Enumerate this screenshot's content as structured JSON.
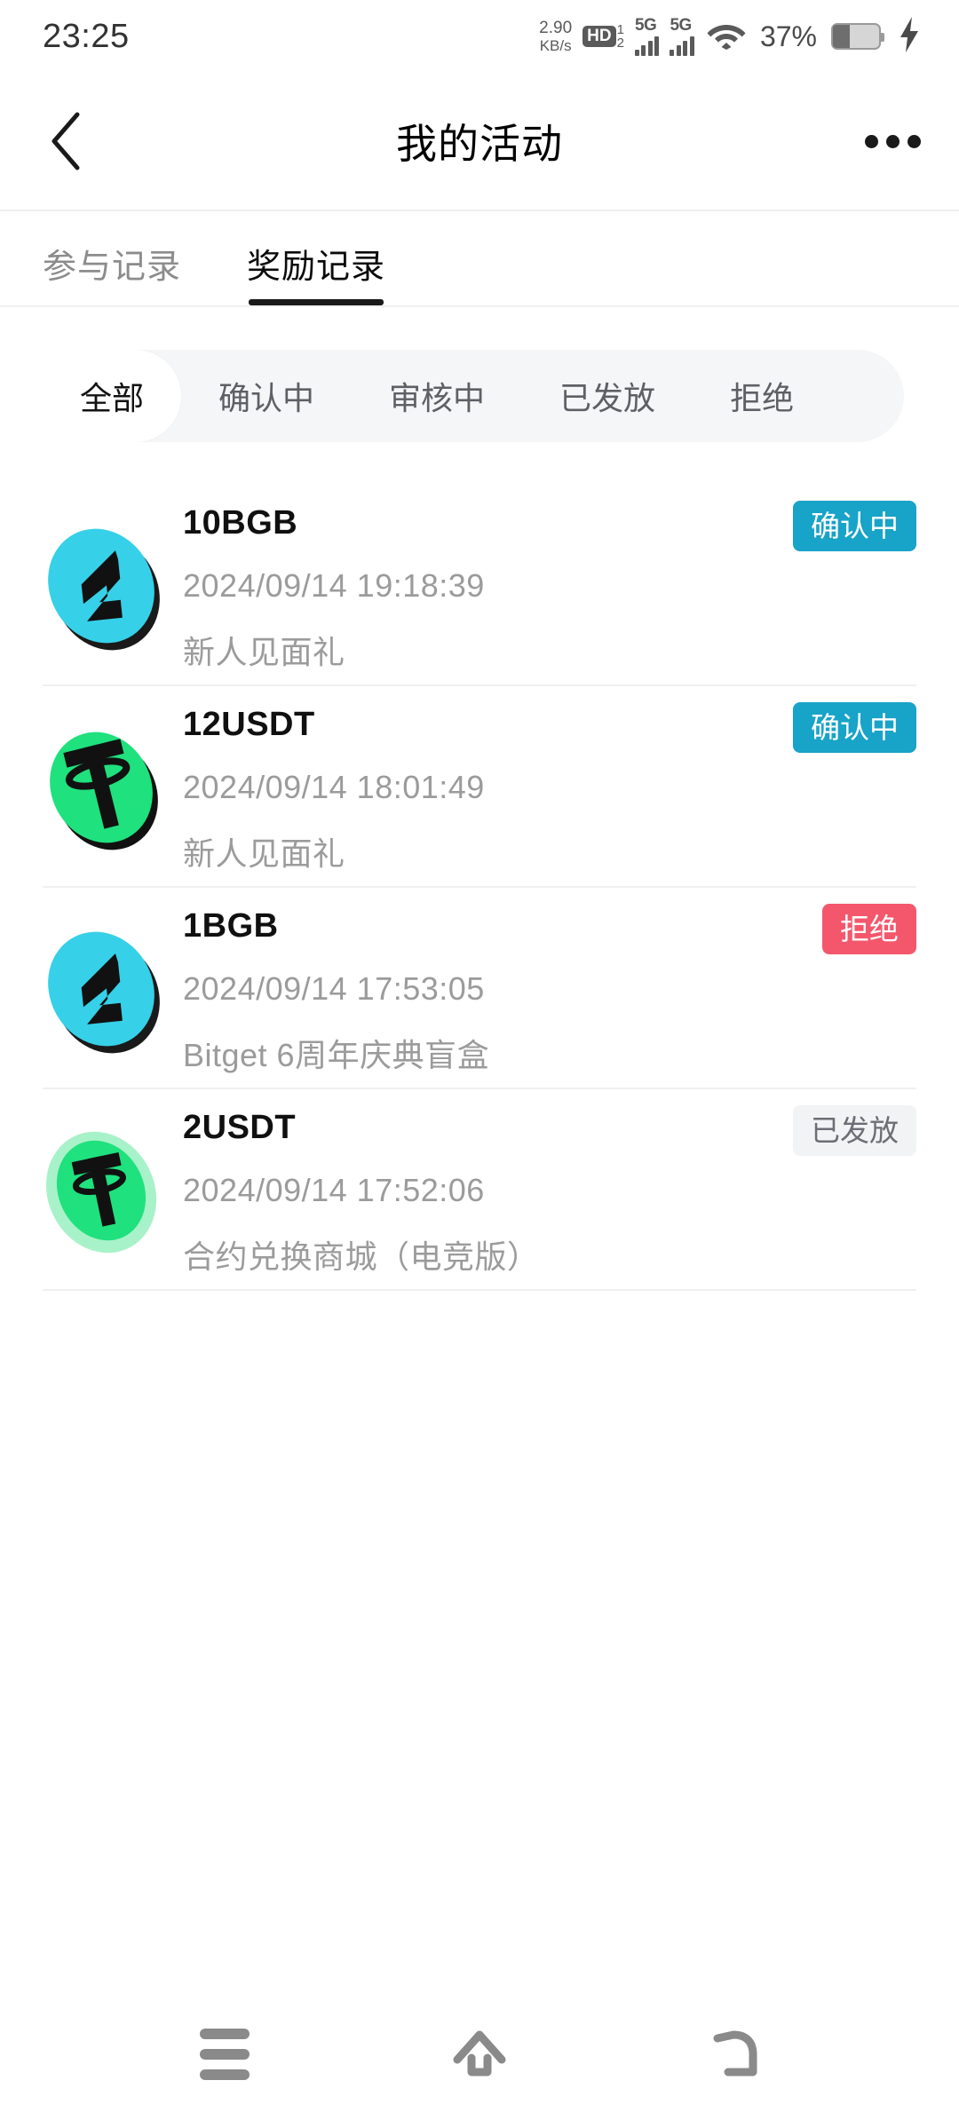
{
  "statusbar": {
    "time": "23:25",
    "net_speed_value": "2.90",
    "net_speed_unit": "KB/s",
    "hd_label": "HD",
    "sim1_label": "1",
    "sim2_label": "2",
    "signal1_gen": "5G",
    "signal2_gen": "5G",
    "battery_percent": "37%",
    "icons": [
      "hd-voice-icon",
      "signal-bars-icon",
      "wifi-icon",
      "battery-icon",
      "charging-bolt-icon"
    ]
  },
  "header": {
    "title": "我的活动",
    "back_icon": "chevron-left-icon",
    "more_icon": "more-horizontal-icon"
  },
  "tabs": [
    {
      "label": "参与记录",
      "active": false
    },
    {
      "label": "奖励记录",
      "active": true
    }
  ],
  "filters": [
    {
      "label": "全部",
      "active": true
    },
    {
      "label": "确认中",
      "active": false
    },
    {
      "label": "审核中",
      "active": false
    },
    {
      "label": "已发放",
      "active": false
    },
    {
      "label": "拒绝",
      "active": false
    }
  ],
  "rewards": [
    {
      "amount": "10BGB",
      "date": "2024/09/14 19:18:39",
      "source": "新人见面礼",
      "status": "确认中",
      "status_type": "pending",
      "coin": "bgb"
    },
    {
      "amount": "12USDT",
      "date": "2024/09/14 18:01:49",
      "source": "新人见面礼",
      "status": "确认中",
      "status_type": "pending",
      "coin": "usdt"
    },
    {
      "amount": "1BGB",
      "date": "2024/09/14 17:53:05",
      "source": "Bitget 6周年庆典盲盒",
      "status": "拒绝",
      "status_type": "rejected",
      "coin": "bgb"
    },
    {
      "amount": "2USDT",
      "date": "2024/09/14 17:52:06",
      "source": "合约兑换商城（电竞版）",
      "status": "已发放",
      "status_type": "issued",
      "coin": "usdt-ring"
    }
  ],
  "navbar": [
    {
      "icon": "recents-menu-icon"
    },
    {
      "icon": "home-icon"
    },
    {
      "icon": "back-icon"
    }
  ],
  "colors": {
    "bgb_cyan": "#36D0E8",
    "usdt_green": "#1FE17D",
    "usdt_green_light": "#A8F2C9",
    "badge_pending": "#18A3C8",
    "badge_rejected": "#F4576C",
    "badge_issued_bg": "#F2F3F5",
    "accent_underline": "#1A1A1A"
  }
}
